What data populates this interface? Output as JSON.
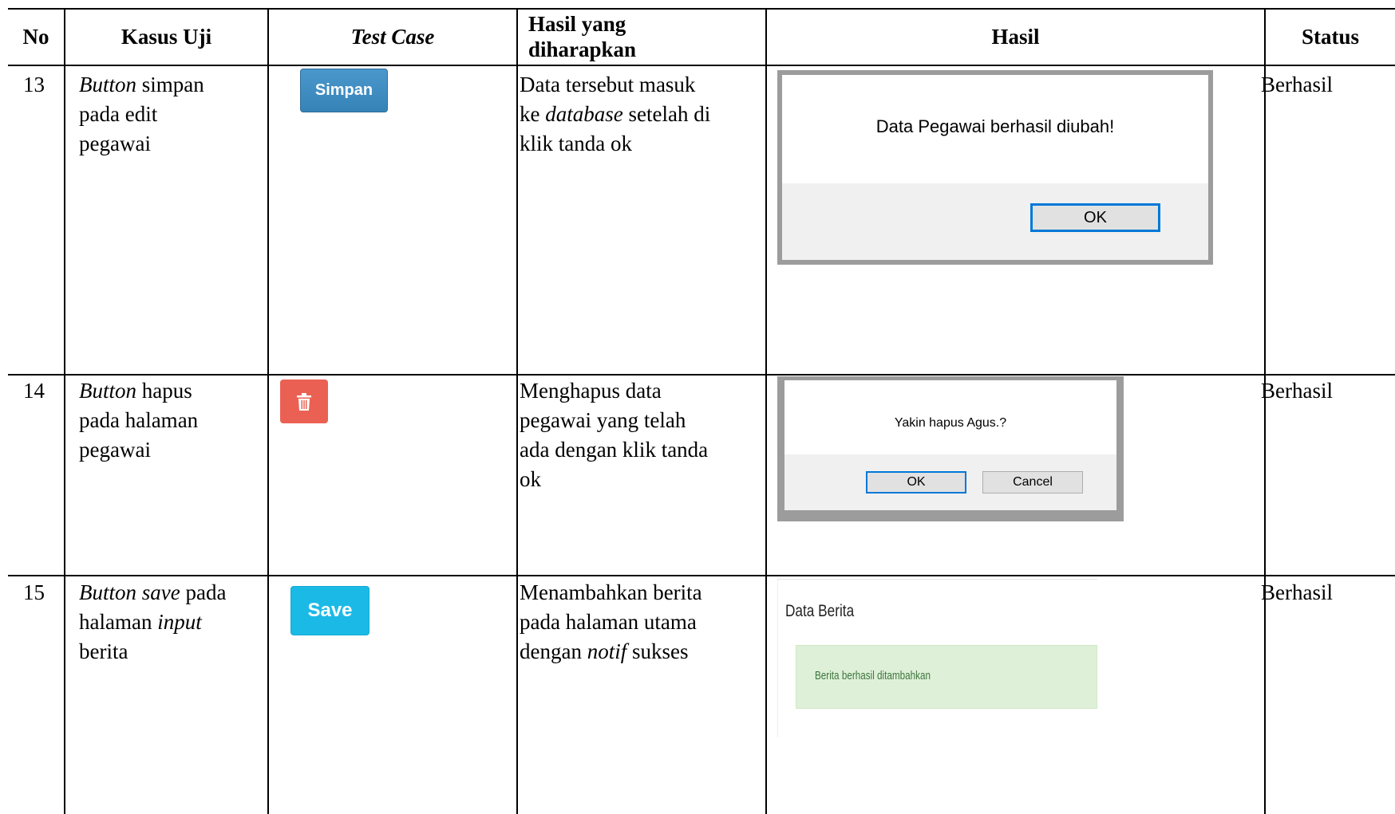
{
  "headers": {
    "no": "No",
    "kasus_uji": "Kasus Uji",
    "test_case": "Test Case",
    "hasil_diharapkan_1": "Hasil yang",
    "hasil_diharapkan_2": "diharapkan",
    "hasil": "Hasil",
    "status": "Status"
  },
  "rows": [
    {
      "no": "13",
      "kasus_em": "Button",
      "kasus_l1": " simpan",
      "kasus_l2": "pada edit",
      "kasus_l3": "pegawai",
      "button_label": "Simpan",
      "exp_l1": "Data tersebut masuk",
      "exp_l2_pre": "ke ",
      "exp_l2_em": "database",
      "exp_l2_post": " setelah di",
      "exp_l3": "klik tanda ok",
      "dialog_msg": "Data Pegawai berhasil diubah!",
      "dialog_ok": "OK",
      "status": "Berhasil"
    },
    {
      "no": "14",
      "kasus_em": "Button",
      "kasus_l1": " hapus",
      "kasus_l2": "pada halaman",
      "kasus_l3": "pegawai",
      "button_icon": "trash-icon",
      "exp_l1": "Menghapus data",
      "exp_l2": "pegawai yang telah",
      "exp_l3": "ada dengan klik tanda",
      "exp_l4": "ok",
      "dialog_msg": "Yakin hapus Agus.?",
      "dialog_ok": "OK",
      "dialog_cancel": "Cancel",
      "status": "Berhasil"
    },
    {
      "no": "15",
      "kasus_em1": "Button save",
      "kasus_l1": " pada",
      "kasus_l2_pre": "halaman ",
      "kasus_l2_em": "input",
      "kasus_l3": "berita",
      "button_label": "Save",
      "exp_l1": "Menambahkan berita",
      "exp_l2": "pada halaman utama",
      "exp_l3_pre": "dengan ",
      "exp_l3_em": "notif",
      "exp_l3_post": " sukses",
      "panel_title": "Data Berita",
      "alert_text": "Berita berhasil ditambahkan",
      "status": "Berhasil"
    }
  ]
}
